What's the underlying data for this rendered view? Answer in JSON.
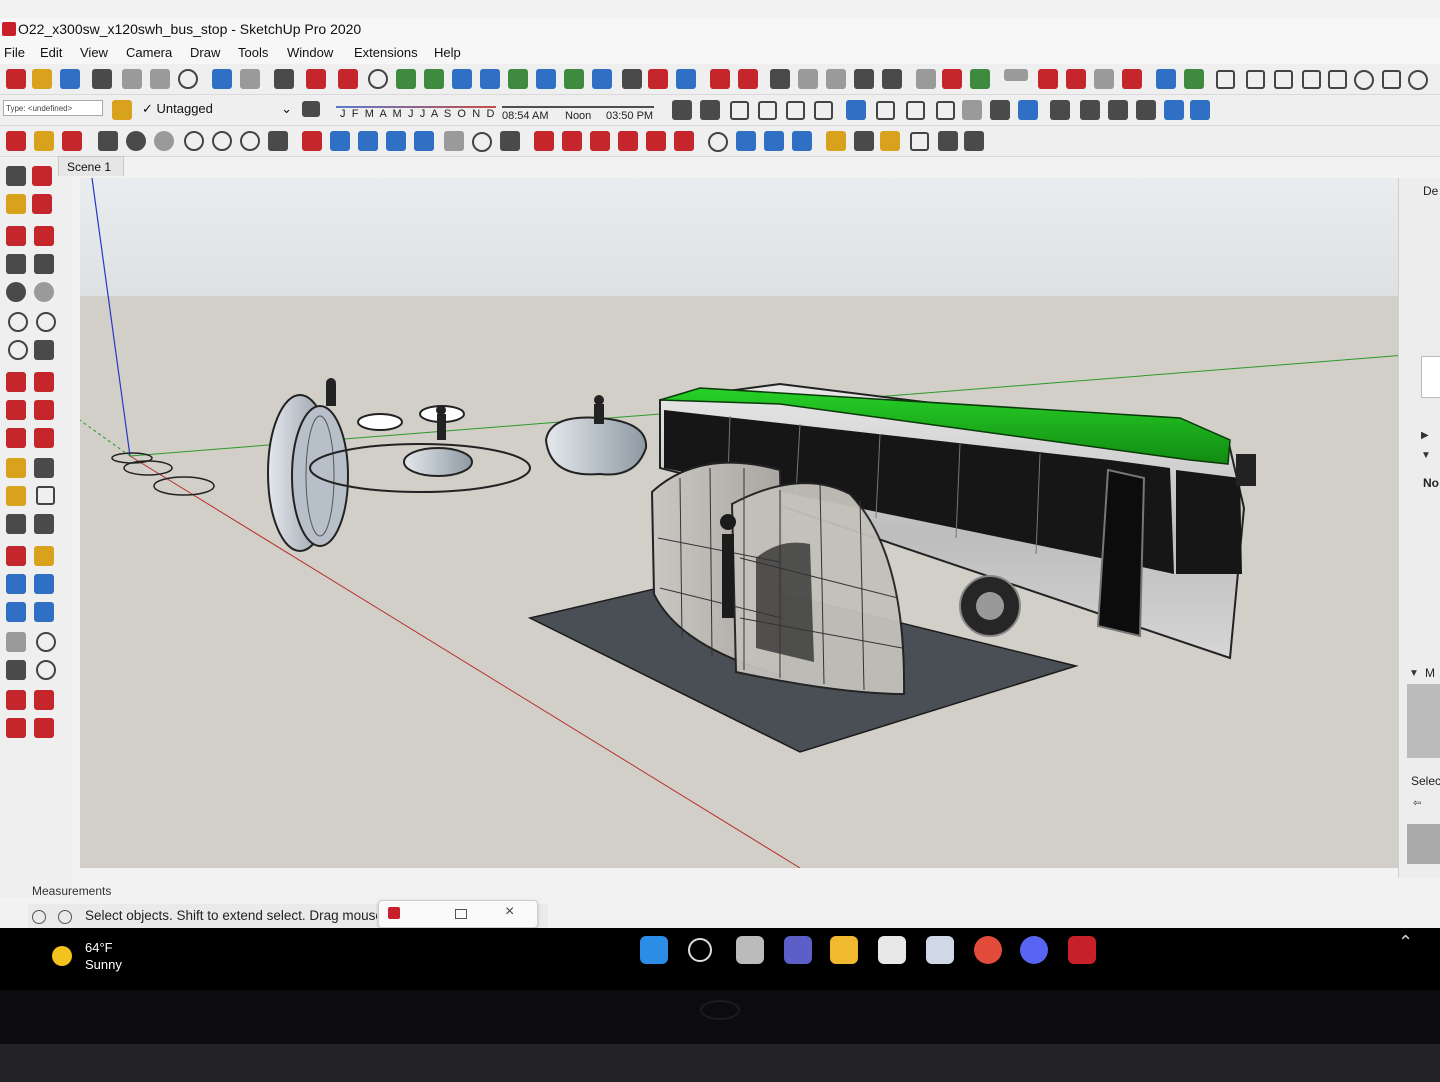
{
  "window": {
    "title": "O22_x300sw_x120swh_bus_stop - SketchUp Pro 2020"
  },
  "menu": [
    "File",
    "Edit",
    "View",
    "Camera",
    "Draw",
    "Tools",
    "Window",
    "Extensions",
    "Help"
  ],
  "toolbar": {
    "type_select": "Type: <undefined>",
    "tag_select": "Untagged",
    "shadow_months": "J F M A M J J A S O N D",
    "time_start": "08:54 AM",
    "time_noon": "Noon",
    "time_end": "03:50 PM"
  },
  "scene_tab": "Scene 1",
  "right_panel": {
    "header_cut": "De",
    "label_no": "No",
    "label_m": "M",
    "label_select": "Selec"
  },
  "measurements_label": "Measurements",
  "status": {
    "text": "Select objects. Shift to extend select. Drag mouse to select multiple."
  },
  "taskbar": {
    "temperature": "64°F",
    "condition": "Sunny"
  },
  "colors": {
    "bus_roof": "#1db31d",
    "ground": "#d1cfc8",
    "sky": "#e9ecee",
    "slab": "#4a4f56",
    "app_red": "#c8202a"
  },
  "icons": [
    "start-icon",
    "search-icon",
    "task-view-icon",
    "teams-icon",
    "file-explorer-icon",
    "dropbox-icon",
    "store-icon",
    "chrome-icon",
    "discord-icon",
    "sketchup-icon"
  ]
}
